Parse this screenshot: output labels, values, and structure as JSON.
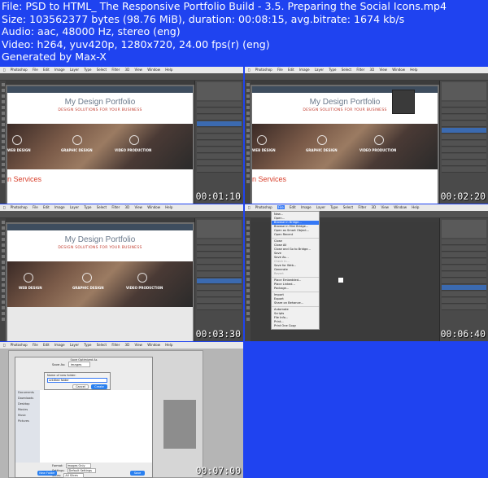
{
  "header": {
    "line1": "File: PSD to HTML_ The Responsive Portfolio Build - 3.5. Preparing the Social Icons.mp4",
    "line2": "Size: 103562377 bytes (98.76 MiB), duration: 00:08:15, avg.bitrate: 1674 kb/s",
    "line3": "Audio: aac, 48000 Hz, stereo (eng)",
    "line4": "Video: h264, yuv420p, 1280x720, 24.00 fps(r) (eng)",
    "line5": "Generated by Max-X"
  },
  "app": {
    "name": "Photoshop",
    "menus": [
      "Photoshop",
      "File",
      "Edit",
      "Image",
      "Layer",
      "Type",
      "Select",
      "Filter",
      "3D",
      "View",
      "Window",
      "Help"
    ]
  },
  "mock": {
    "title": "My Design Portfolio",
    "subtitle": "DESIGN SOLUTIONS FOR YOUR BUSINESS",
    "services": [
      "WEB DESIGN",
      "GRAPHIC DESIGN",
      "VIDEO PRODUCTION"
    ],
    "section": "n Services"
  },
  "thumbs": [
    {
      "timestamp": "00:01:10"
    },
    {
      "timestamp": "00:02:20"
    },
    {
      "timestamp": "00:03:30"
    },
    {
      "timestamp": "00:06:40"
    },
    {
      "timestamp": "00:07:00"
    }
  ],
  "file_menu": {
    "items": [
      "New...",
      "Open...",
      "Browse in Bridge...",
      "Browse in Mini Bridge...",
      "Open as Smart Object...",
      "Open Recent",
      "Close",
      "Close All",
      "Close and Go to Bridge...",
      "Save",
      "Save As...",
      "Check In...",
      "Save for Web...",
      "Generate",
      "Revert",
      "Place Embedded...",
      "Place Linked...",
      "Package...",
      "Import",
      "Export",
      "Share on Behance...",
      "Automate",
      "Scripts",
      "File Info...",
      "Print...",
      "Print One Copy"
    ],
    "highlighted": "Browse in Bridge..."
  },
  "save_dialog": {
    "title": "Save Optimized As",
    "save_as_label": "Save As:",
    "save_as_value": "images",
    "new_folder_label": "Name of new folder:",
    "new_folder_value": "untitled folder",
    "cancel": "Cancel",
    "create": "Create",
    "sidebar": [
      "Documents",
      "Downloads",
      "Desktop",
      "Movies",
      "Music",
      "Pictures"
    ],
    "new_folder_button": "New Folder",
    "format_label": "Format:",
    "format_value": "Images Only",
    "settings_label": "Settings:",
    "settings_value": "Default Settings",
    "slices_label": "Slices:",
    "slices_value": "All Slices",
    "save_button": "Save"
  },
  "colors": {
    "background": "#1f43f0",
    "header_text": "#ffffff",
    "accent_red": "#d8402c",
    "title_grey": "#6b7a8c"
  }
}
